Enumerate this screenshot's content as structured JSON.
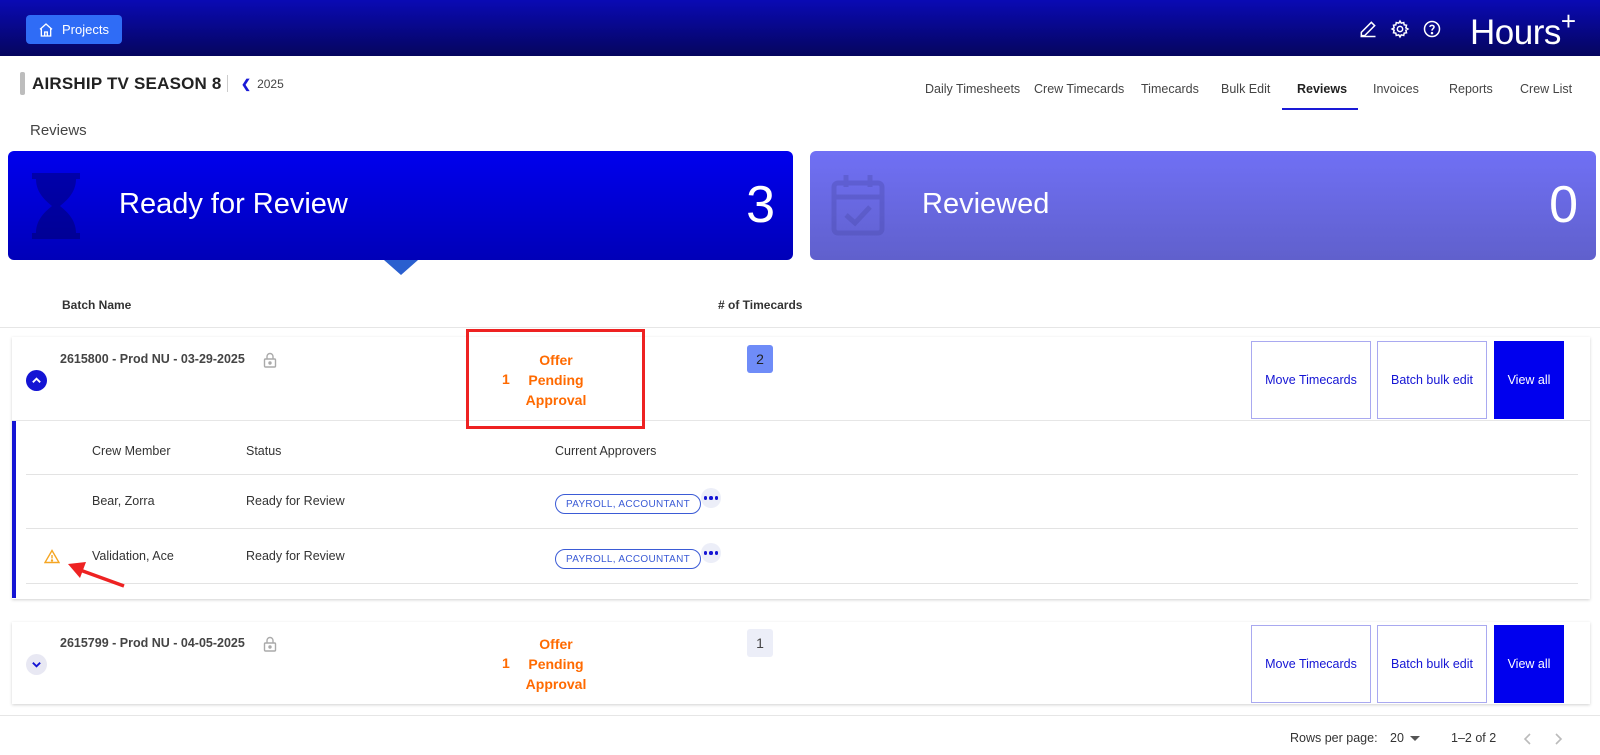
{
  "topbar": {
    "projects_label": "Projects",
    "brand": "Hours",
    "brand_sup": "+",
    "icons": [
      "pencil-icon",
      "gear-icon",
      "help-icon"
    ]
  },
  "project": {
    "title": "AIRSHIP TV SEASON 8",
    "year": "2025"
  },
  "tabs": [
    {
      "label": "Daily Timesheets"
    },
    {
      "label": "Crew Timecards"
    },
    {
      "label": "Timecards"
    },
    {
      "label": "Bulk Edit"
    },
    {
      "label": "Reviews",
      "active": true
    },
    {
      "label": "Invoices"
    },
    {
      "label": "Reports"
    },
    {
      "label": "Crew List"
    }
  ],
  "section_title": "Reviews",
  "cards": {
    "ready": {
      "label": "Ready for Review",
      "count": "3"
    },
    "reviewed": {
      "label": "Reviewed",
      "count": "0"
    }
  },
  "table": {
    "col_batch": "Batch Name",
    "col_timecards": "# of Timecards"
  },
  "batches": [
    {
      "name": "2615800 - Prod NU - 03-29-2025",
      "offer_count": "1",
      "offer_l1": "Offer",
      "offer_l2": "Pending",
      "offer_l3": "Approval",
      "timecards": "2",
      "move": "Move Timecards",
      "bulk": "Batch bulk edit",
      "view": "View all"
    },
    {
      "name": "2615799 - Prod NU - 04-05-2025",
      "offer_count": "1",
      "offer_l1": "Offer",
      "offer_l2": "Pending",
      "offer_l3": "Approval",
      "timecards": "1",
      "move": "Move Timecards",
      "bulk": "Batch bulk edit",
      "view": "View all"
    }
  ],
  "expanded": {
    "col_crew": "Crew Member",
    "col_status": "Status",
    "col_approvers": "Current Approvers",
    "rows": [
      {
        "crew": "Bear, Zorra",
        "status": "Ready for Review",
        "approvers": "PAYROLL, ACCOUNTANT",
        "warning": false
      },
      {
        "crew": "Validation, Ace",
        "status": "Ready for Review",
        "approvers": "PAYROLL, ACCOUNTANT",
        "warning": true
      }
    ]
  },
  "footer": {
    "rows_label": "Rows per page:",
    "rows_value": "20",
    "range": "1–2 of 2"
  },
  "colors": {
    "accent": "#0000ee",
    "warning": "#ff6a00",
    "annotation": "#ee2222"
  }
}
